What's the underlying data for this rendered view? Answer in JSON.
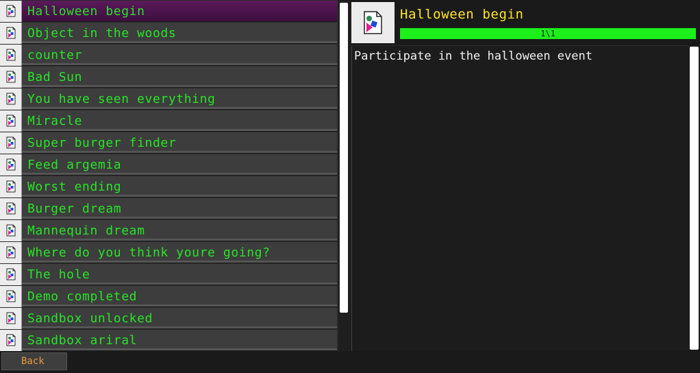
{
  "achievements": [
    {
      "label": "Halloween begin",
      "selected": true
    },
    {
      "label": "Object in the woods",
      "selected": false
    },
    {
      "label": "counter",
      "selected": false
    },
    {
      "label": "Bad Sun",
      "selected": false
    },
    {
      "label": "You have seen everything",
      "selected": false
    },
    {
      "label": "Miracle",
      "selected": false
    },
    {
      "label": "Super burger finder",
      "selected": false
    },
    {
      "label": "Feed argemia",
      "selected": false
    },
    {
      "label": "Worst ending",
      "selected": false
    },
    {
      "label": "Burger dream",
      "selected": false
    },
    {
      "label": "Mannequin dream",
      "selected": false
    },
    {
      "label": "Where do you think youre going?",
      "selected": false
    },
    {
      "label": "The hole",
      "selected": false
    },
    {
      "label": "Demo completed",
      "selected": false
    },
    {
      "label": "Sandbox unlocked",
      "selected": false
    },
    {
      "label": "Sandbox ariral",
      "selected": false
    }
  ],
  "detail": {
    "title": "Halloween begin",
    "progress_text": "1\\1",
    "progress_fraction": 1.0,
    "description": "Participate in the halloween event",
    "icon": "missing-image-icon"
  },
  "footer": {
    "back_label": "Back"
  },
  "colors": {
    "label_green": "#27e427",
    "title_yellow": "#ffe62a",
    "progress_green": "#1bf01b",
    "selected_purple": "#5a1a5a",
    "back_orange": "#e89a3c"
  }
}
